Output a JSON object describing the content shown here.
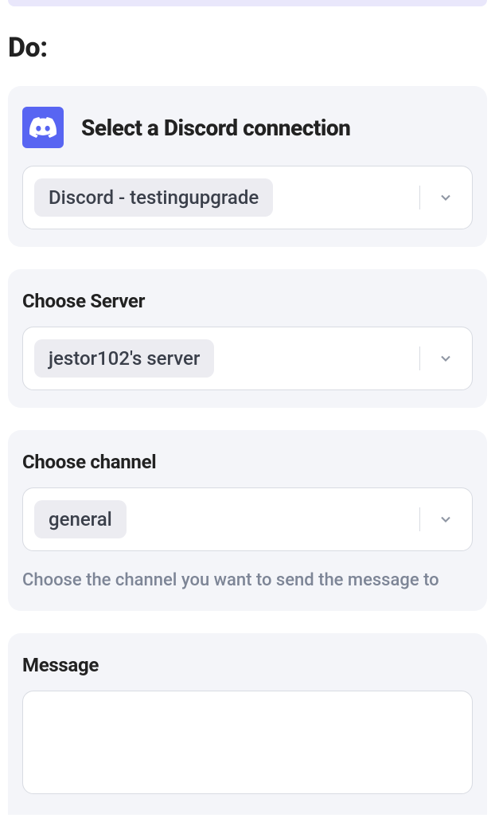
{
  "heading": "Do:",
  "sections": {
    "connection": {
      "title": "Select a Discord connection",
      "value": "Discord - testingupgrade"
    },
    "server": {
      "label": "Choose Server",
      "value": "jestor102's server"
    },
    "channel": {
      "label": "Choose channel",
      "value": "general",
      "helper": "Choose the channel you want to send the message to"
    },
    "message": {
      "label": "Message",
      "value": ""
    }
  }
}
